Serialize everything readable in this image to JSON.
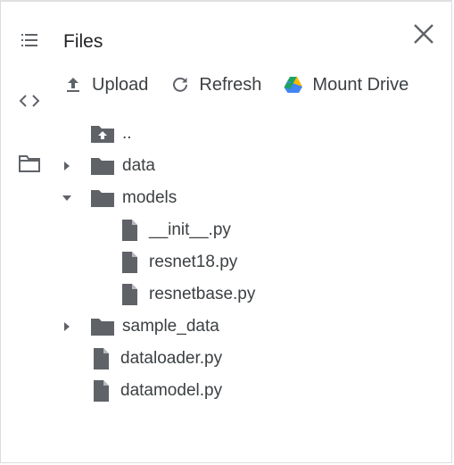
{
  "panel": {
    "title": "Files"
  },
  "toolbar": {
    "upload_label": "Upload",
    "refresh_label": "Refresh",
    "mount_label": "Mount Drive"
  },
  "tree": {
    "parent_label": "..",
    "items": [
      {
        "label": "data",
        "type": "folder",
        "state": "collapsed"
      },
      {
        "label": "models",
        "type": "folder",
        "state": "expanded"
      },
      {
        "label": "__init__.py",
        "type": "file"
      },
      {
        "label": "resnet18.py",
        "type": "file"
      },
      {
        "label": "resnetbase.py",
        "type": "file"
      },
      {
        "label": "sample_data",
        "type": "folder",
        "state": "collapsed"
      },
      {
        "label": "dataloader.py",
        "type": "file"
      },
      {
        "label": "datamodel.py",
        "type": "file"
      }
    ]
  },
  "icons": {
    "rail": [
      "list-icon",
      "code-icon",
      "folder-outline-icon"
    ],
    "close": "close-icon",
    "upload": "upload-icon",
    "refresh": "refresh-icon",
    "mount": "google-drive-icon"
  },
  "colors": {
    "icon_gray": "#5f6368",
    "folder_gray": "#5f6368",
    "text": "#3c4043",
    "drive_green": "#1ea362",
    "drive_yellow": "#ffba00",
    "drive_blue": "#4285f4"
  }
}
